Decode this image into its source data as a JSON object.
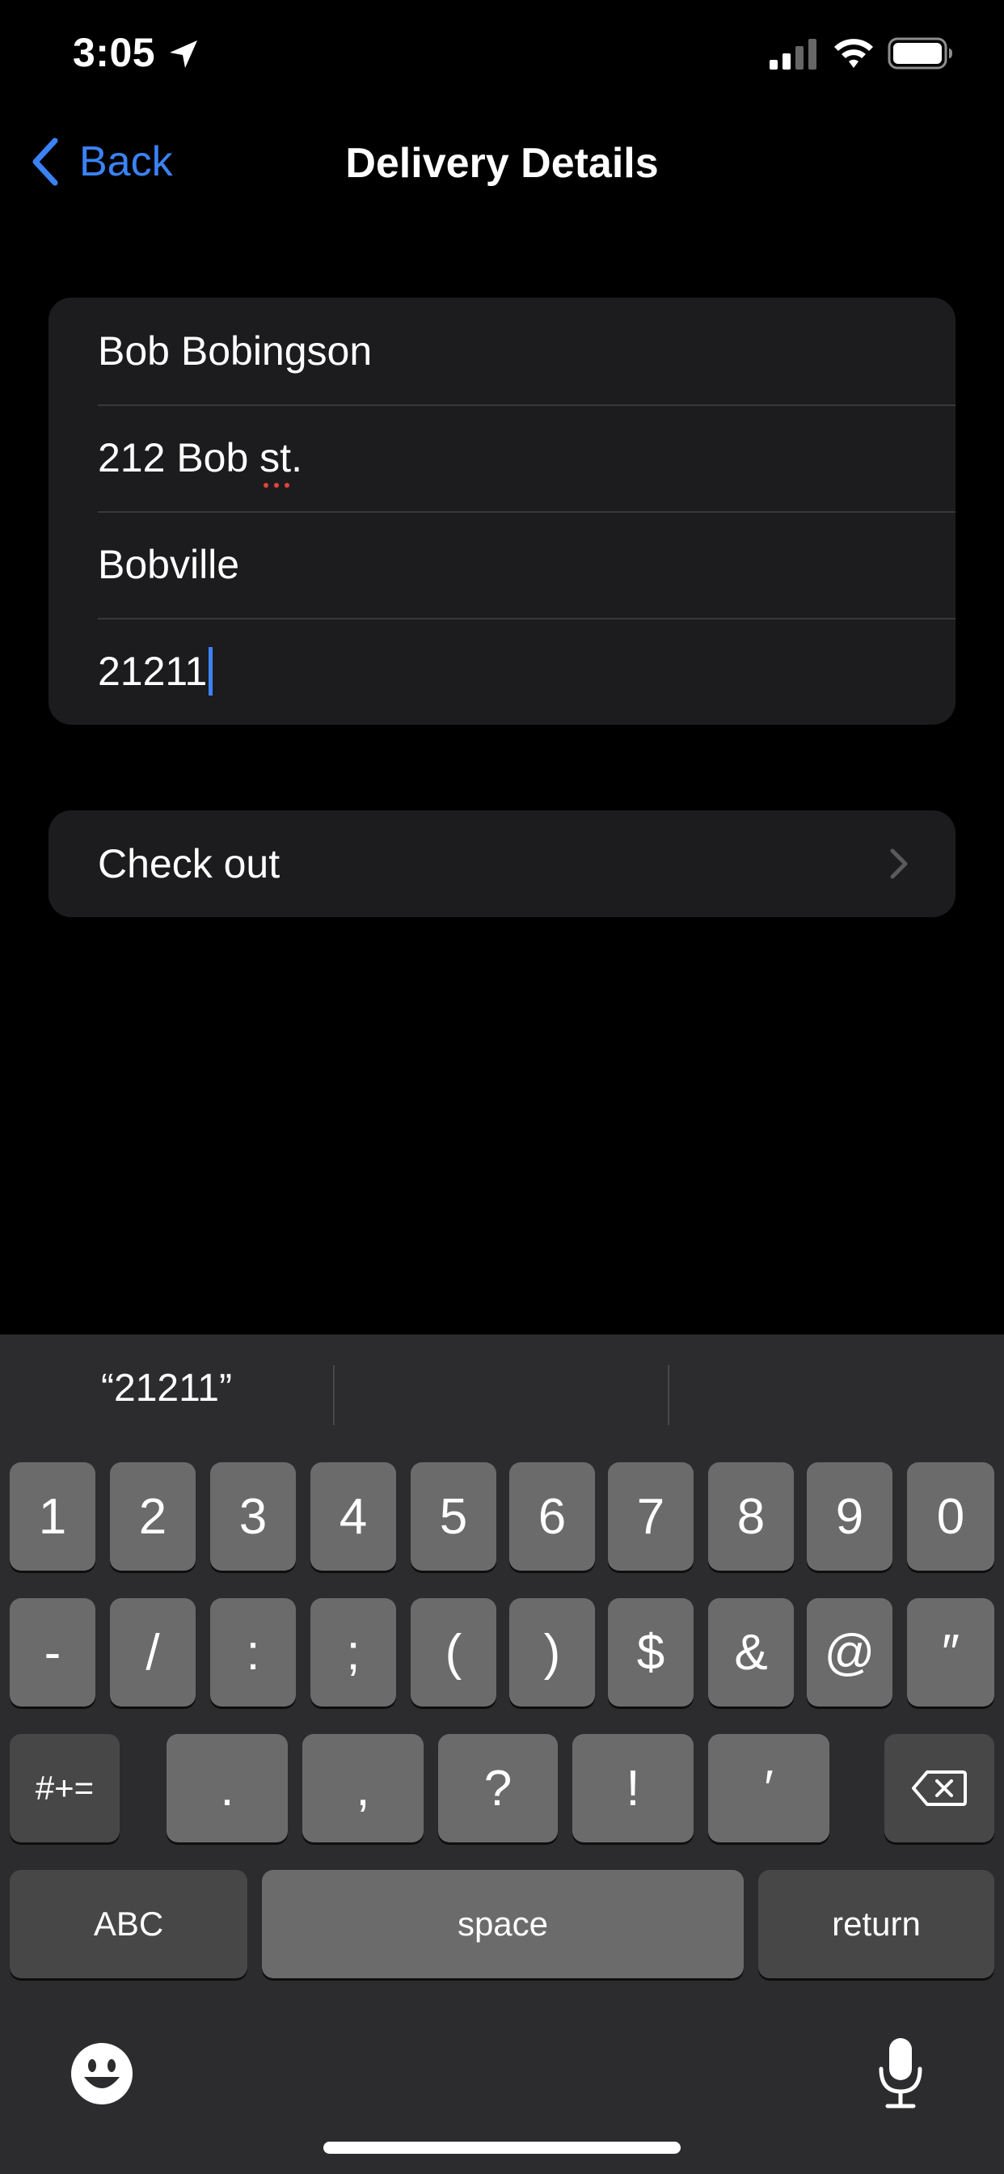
{
  "status_bar": {
    "time": "3:05"
  },
  "nav": {
    "back_label": "Back",
    "title": "Delivery Details"
  },
  "form": {
    "fields": [
      {
        "value": "Bob Bobingson"
      },
      {
        "value_before": "212 Bob ",
        "value_misspelled": "st",
        "value_after": "."
      },
      {
        "value": "Bobville"
      },
      {
        "value": "21211"
      }
    ]
  },
  "checkout": {
    "label": "Check out"
  },
  "keyboard": {
    "suggestions": [
      "“21211”",
      "",
      ""
    ],
    "row1": [
      "1",
      "2",
      "3",
      "4",
      "5",
      "6",
      "7",
      "8",
      "9",
      "0"
    ],
    "row2": [
      "-",
      "/",
      ":",
      ";",
      "(",
      ")",
      "$",
      "&",
      "@",
      "″"
    ],
    "row3": {
      "toggle": "#+=",
      "keys": [
        ".",
        ",",
        "?",
        "!",
        "′"
      ]
    },
    "row4": {
      "abc": "ABC",
      "space": "space",
      "return": "return"
    }
  },
  "colors": {
    "accent": "#3b82f6",
    "card": "#1c1c1e",
    "keyboard_bg": "#2c2c2e",
    "key": "#6b6b6b",
    "key_dark": "#474747"
  }
}
